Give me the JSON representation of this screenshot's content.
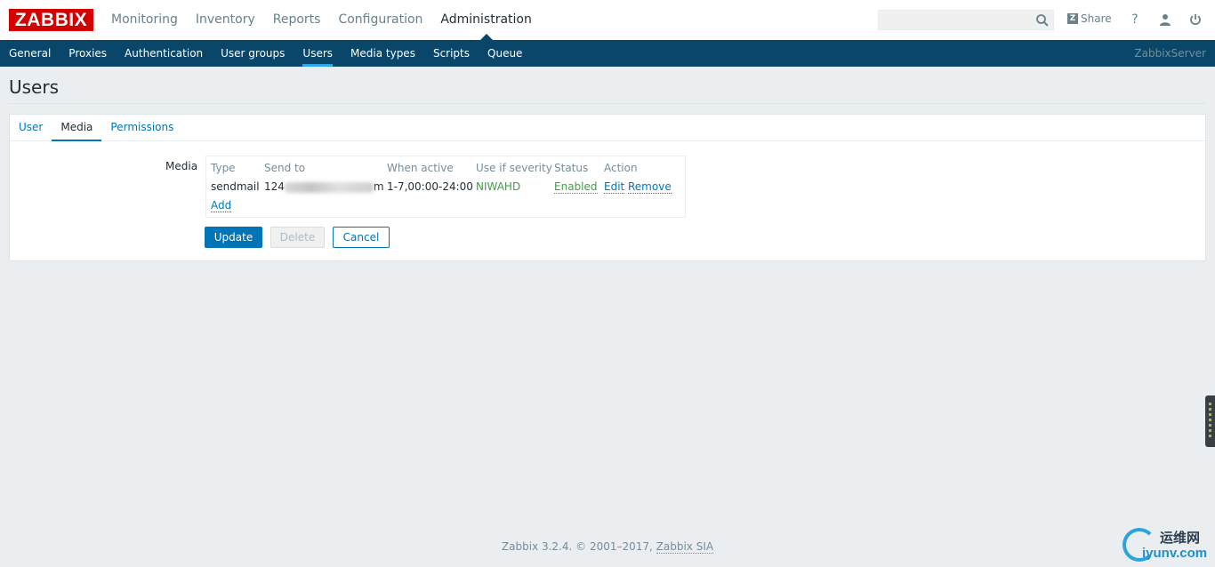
{
  "brand": {
    "logo_text": "ZABBIX",
    "accent": "#d40000",
    "nav_bg": "#0a466a",
    "link": "#0275b8",
    "ok": "#429e47"
  },
  "topnav": {
    "items": [
      {
        "label": "Monitoring"
      },
      {
        "label": "Inventory"
      },
      {
        "label": "Reports"
      },
      {
        "label": "Configuration"
      },
      {
        "label": "Administration",
        "active": true
      }
    ],
    "search": {
      "value": "",
      "placeholder": "",
      "icon": "search-icon"
    },
    "share_label": "Share",
    "help_icon": "help-icon",
    "profile_icon": "user-icon",
    "signout_icon": "power-icon"
  },
  "subnav": {
    "items": [
      {
        "label": "General"
      },
      {
        "label": "Proxies"
      },
      {
        "label": "Authentication"
      },
      {
        "label": "User groups"
      },
      {
        "label": "Users",
        "active": true
      },
      {
        "label": "Media types"
      },
      {
        "label": "Scripts"
      },
      {
        "label": "Queue"
      }
    ],
    "server_name": "ZabbixServer"
  },
  "page": {
    "title": "Users"
  },
  "tabs": [
    {
      "label": "User"
    },
    {
      "label": "Media",
      "active": true
    },
    {
      "label": "Permissions"
    }
  ],
  "media": {
    "label": "Media",
    "headers": [
      "Type",
      "Send to",
      "When active",
      "Use if severity",
      "Status",
      "Action"
    ],
    "rows": [
      {
        "type": "sendmail",
        "send_to_prefix": "124",
        "send_to_suffix": "m",
        "when_active": "1-7,00:00-24:00",
        "severity": "NIWAHD",
        "status": "Enabled",
        "edit": "Edit",
        "remove": "Remove"
      }
    ],
    "add_label": "Add"
  },
  "buttons": {
    "update": "Update",
    "delete": "Delete",
    "cancel": "Cancel"
  },
  "footer": {
    "text": "Zabbix 3.2.4. © 2001–2017, ",
    "link": "Zabbix SIA"
  },
  "watermark": {
    "cn": "运维网",
    "en": "iyunv.com"
  }
}
